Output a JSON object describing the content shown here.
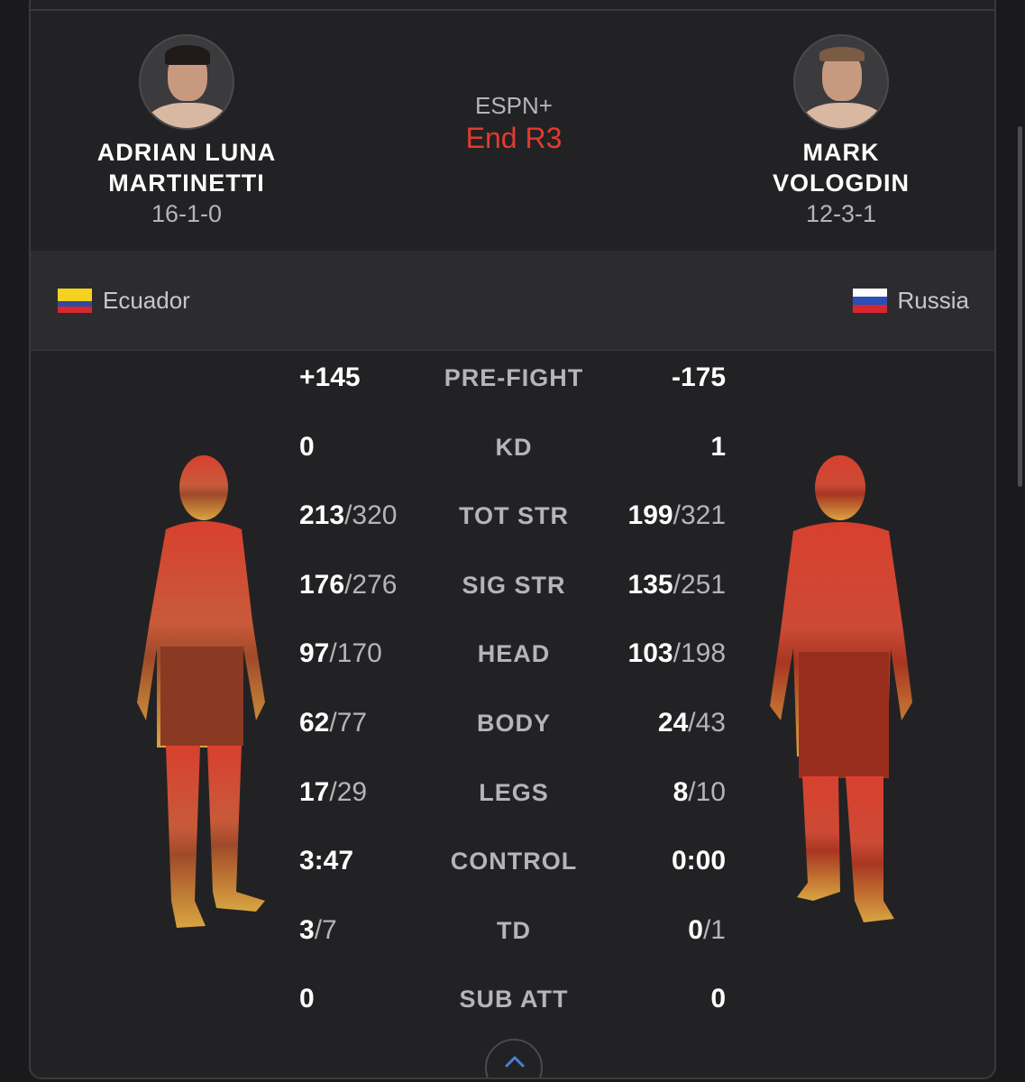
{
  "event": {
    "network": "ESPN+",
    "status": "End R3"
  },
  "fighters": {
    "left": {
      "name_line1": "ADRIAN LUNA",
      "name_line2": "MARTINETTI",
      "record": "16-1-0",
      "country": "Ecuador",
      "flag_colors": [
        "#f4d21f",
        "#f4d21f",
        "#2f4aa0",
        "#d8262e"
      ]
    },
    "right": {
      "name_line1": "MARK",
      "name_line2": "VOLOGDIN",
      "record": "12-3-1",
      "country": "Russia",
      "flag_colors": [
        "#ffffff",
        "#2a4fb8",
        "#d8262e"
      ]
    }
  },
  "stats": [
    {
      "label": "PRE-FIGHT",
      "left_num": "+145",
      "left_den": "",
      "right_num": "-175",
      "right_den": ""
    },
    {
      "label": "KD",
      "left_num": "0",
      "left_den": "",
      "right_num": "1",
      "right_den": ""
    },
    {
      "label": "TOT STR",
      "left_num": "213",
      "left_den": "/320",
      "right_num": "199",
      "right_den": "/321"
    },
    {
      "label": "SIG STR",
      "left_num": "176",
      "left_den": "/276",
      "right_num": "135",
      "right_den": "/251"
    },
    {
      "label": "HEAD",
      "left_num": "97",
      "left_den": "/170",
      "right_num": "103",
      "right_den": "/198"
    },
    {
      "label": "BODY",
      "left_num": "62",
      "left_den": "/77",
      "right_num": "24",
      "right_den": "/43"
    },
    {
      "label": "LEGS",
      "left_num": "17",
      "left_den": "/29",
      "right_num": "8",
      "right_den": "/10"
    },
    {
      "label": "CONTROL",
      "left_num": "3:47",
      "left_den": "",
      "right_num": "0:00",
      "right_den": ""
    },
    {
      "label": "TD",
      "left_num": "3",
      "left_den": "/7",
      "right_num": "0",
      "right_den": "/1"
    },
    {
      "label": "SUB ATT",
      "left_num": "0",
      "left_den": "",
      "right_num": "0",
      "right_den": ""
    }
  ],
  "colors": {
    "accent_red": "#e33b2e",
    "expand_chevron": "#4a7fd8"
  },
  "icons": {
    "expand": "chevron-up-icon"
  }
}
